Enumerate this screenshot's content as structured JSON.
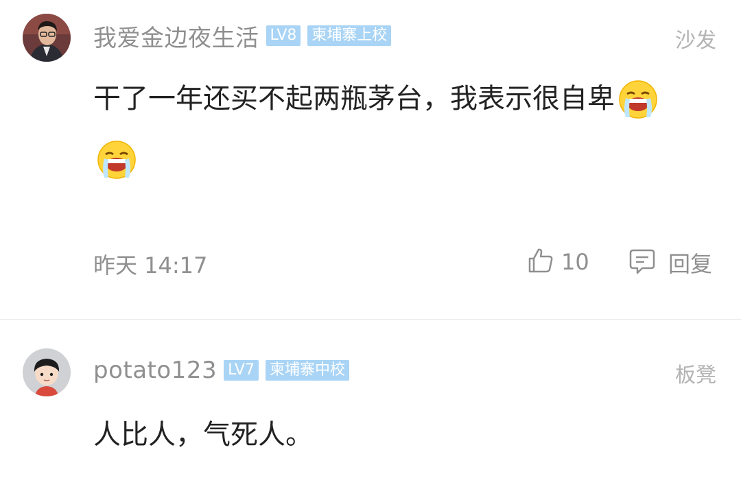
{
  "comments": [
    {
      "username": "我爱金边夜生活",
      "level": "LV8",
      "rank": "柬埔寨上校",
      "floor": "沙发",
      "text": "干了一年还买不起两瓶茅台，我表示很自卑",
      "emojis": [
        "crying-face-emoji",
        "crying-face-emoji"
      ],
      "time": "昨天 14:17",
      "likes": "10",
      "reply_label": "回复"
    },
    {
      "username": "potato123",
      "level": "LV7",
      "rank": "柬埔寨中校",
      "floor": "板凳",
      "text": "人比人，气死人。"
    }
  ],
  "colors": {
    "badge_bg": "#a9d4f5",
    "meta_text": "#8f8f8f",
    "divider": "#e6e6e6"
  }
}
